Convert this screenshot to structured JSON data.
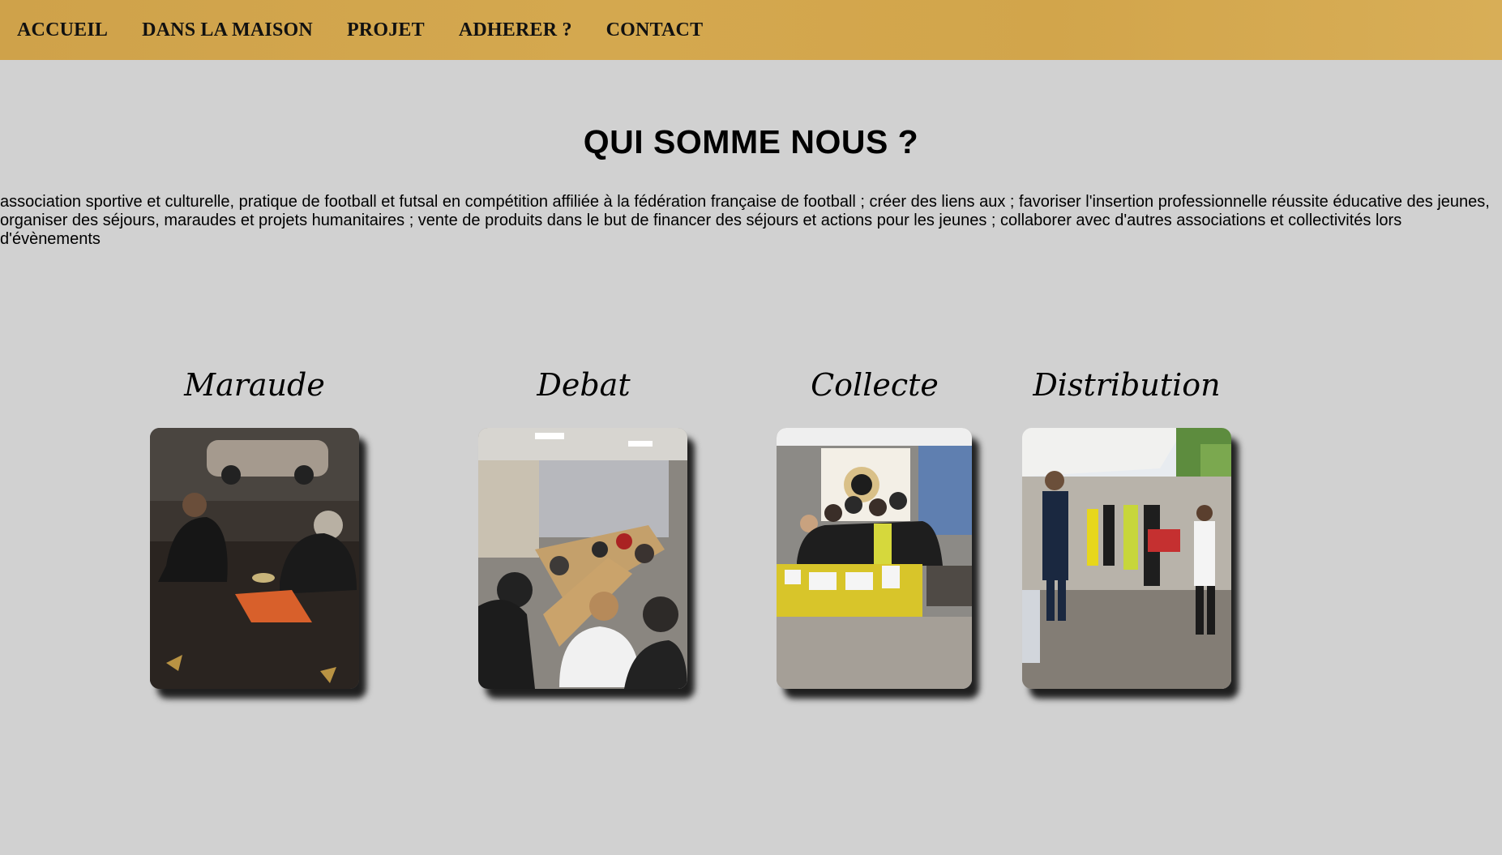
{
  "nav": {
    "items": [
      {
        "label": "ACCUEIL"
      },
      {
        "label": "DANS LA MAISON"
      },
      {
        "label": "PROJET"
      },
      {
        "label": "ADHERER ?"
      },
      {
        "label": "CONTACT"
      }
    ]
  },
  "main": {
    "title": "QUI SOMME NOUS ?",
    "description": "association sportive et culturelle, pratique de football et futsal en compétition affiliée à la fédération française de football ; créer des liens aux ; favoriser l'insertion professionnelle réussite éducative des jeunes, organiser des séjours, maraudes et projets humanitaires ; vente de produits dans le but de financer des séjours et actions pour les jeunes ; collaborer avec d'autres associations et collectivités lors d'évènements"
  },
  "cards": [
    {
      "label": "Maraude"
    },
    {
      "label": "Debat"
    },
    {
      "label": "Collecte"
    },
    {
      "label": "Distribution"
    }
  ],
  "colors": {
    "nav_background": "#d2a54b",
    "page_background": "#d1d1d1"
  }
}
